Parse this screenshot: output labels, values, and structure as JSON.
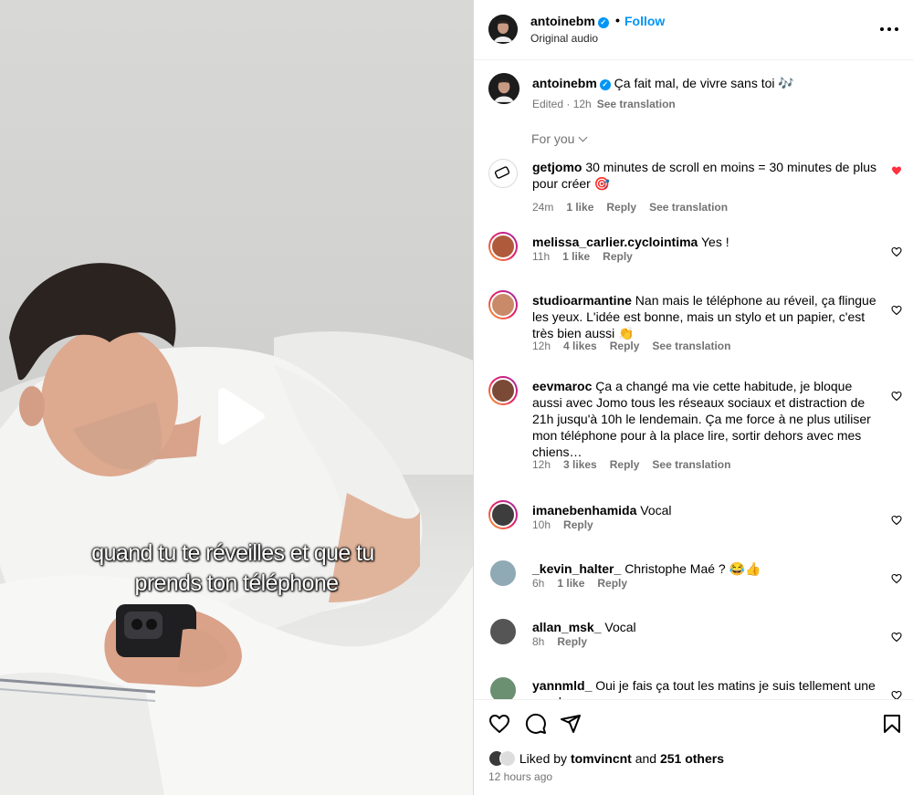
{
  "video": {
    "caption_line1": "quand tu te réveilles et que tu",
    "caption_line2": "prends ton téléphone"
  },
  "header": {
    "username": "antoinebm",
    "separator": "•",
    "follow_label": "Follow",
    "audio_label": "Original audio"
  },
  "post_caption": {
    "username": "antoinebm",
    "text": "Ça fait mal, de vivre sans toi 🎶",
    "edited": "Edited · 12h",
    "see_translation": "See translation"
  },
  "sort_label": "For you",
  "comments": [
    {
      "username": "getjomo",
      "text": "30 minutes de scroll en moins = 30 minutes de plus pour créer 🎯",
      "time": "24m",
      "likes": "1 like",
      "reply": "Reply",
      "translation": "See translation",
      "liked": true
    },
    {
      "username": "melissa_carlier.cyclointima",
      "text": "Yes !",
      "time": "11h",
      "likes": "1 like",
      "reply": "Reply",
      "translation": "",
      "liked": false
    },
    {
      "username": "studioarmantine",
      "text": "Nan mais le téléphone au réveil, ça flingue les yeux. L'idée est bonne, mais un stylo et un papier, c'est très bien aussi 👏",
      "time": "12h",
      "likes": "4 likes",
      "reply": "Reply",
      "translation": "See translation",
      "liked": false
    },
    {
      "username": "eevmaroc",
      "text": "Ça a changé ma vie cette habitude, je bloque aussi avec Jomo tous les réseaux sociaux et distraction de 21h jusqu'à 10h le lendemain. Ça me force à ne plus utiliser mon téléphone pour à la place lire, sortir dehors avec mes chiens…",
      "time": "12h",
      "likes": "3 likes",
      "reply": "Reply",
      "translation": "See translation",
      "liked": false
    },
    {
      "username": "imanebenhamida",
      "text": "Vocal",
      "time": "10h",
      "likes": "",
      "reply": "Reply",
      "translation": "",
      "liked": false
    },
    {
      "username": "_kevin_halter_",
      "text": "Christophe Maé ? 😂👍",
      "time": "6h",
      "likes": "1 like",
      "reply": "Reply",
      "translation": "",
      "liked": false
    },
    {
      "username": "allan_msk_",
      "text": "Vocal",
      "time": "8h",
      "likes": "",
      "reply": "Reply",
      "translation": "",
      "liked": false
    },
    {
      "username": "yannmld_",
      "text": "Oui je fais ça tout les matins je suis tellement une merde",
      "time": "",
      "likes": "",
      "reply": "",
      "translation": "",
      "liked": false
    }
  ],
  "footer": {
    "liked_by_prefix": "Liked by",
    "liked_by_user": "tomvincnt",
    "liked_by_and": "and",
    "liked_by_others": "251 others",
    "timestamp": "12 hours ago"
  },
  "colors": {
    "accent": "#0095f6",
    "heart_red": "#ff3040",
    "muted": "#737373"
  },
  "icons": [
    "verified-icon",
    "more-icon",
    "chevron-down-icon",
    "heart-icon",
    "comment-icon",
    "share-icon",
    "bookmark-icon",
    "play-icon"
  ]
}
